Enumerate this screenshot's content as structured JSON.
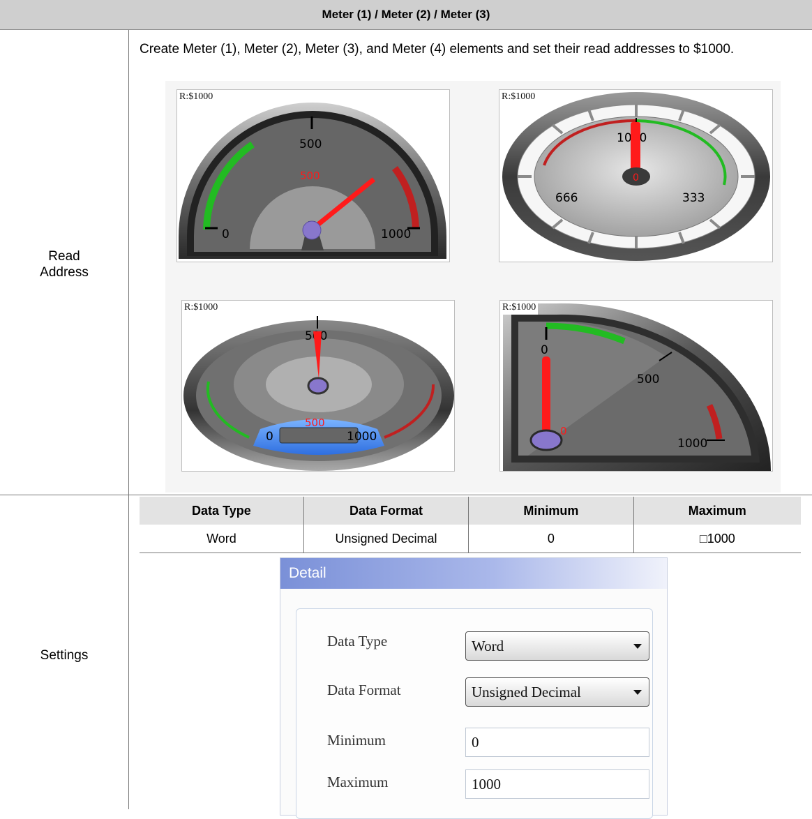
{
  "header": {
    "title": "Meter (1) / Meter (2) / Meter (3)"
  },
  "rows": {
    "read_address": "Read Address",
    "settings": "Settings"
  },
  "intro": "Create Meter (1), Meter (2), Meter (3), and Meter (4) elements and set their read addresses to $1000.",
  "meters": [
    {
      "read_tag": "R:$1000",
      "scale": [
        "0",
        "500",
        "1000"
      ],
      "value_text": "500"
    },
    {
      "read_tag": "R:$1000",
      "scale": [
        "1000",
        "666",
        "333"
      ],
      "value_text": "0"
    },
    {
      "read_tag": "R:$1000",
      "scale": [
        "500",
        "0",
        "1000"
      ],
      "value_text": "500"
    },
    {
      "read_tag": "R:$1000",
      "scale": [
        "0",
        "500",
        "1000"
      ],
      "value_text": "0"
    }
  ],
  "table": {
    "headers": [
      "Data Type",
      "Data Format",
      "Minimum",
      "Maximum"
    ],
    "row": [
      "Word",
      "Unsigned Decimal",
      "0",
      "□1000"
    ]
  },
  "detail": {
    "title": "Detail",
    "data_type_label": "Data Type",
    "data_type_value": "Word",
    "data_format_label": "Data Format",
    "data_format_value": "Unsigned Decimal",
    "minimum_label": "Minimum",
    "minimum_value": "0",
    "maximum_label": "Maximum",
    "maximum_value": "1000"
  },
  "colors": {
    "header_bg": "#cfcfcf",
    "green_zone": "#22bb22",
    "red_zone": "#c02020",
    "needle": "#ff1a1a",
    "hub": "#8877cc"
  }
}
